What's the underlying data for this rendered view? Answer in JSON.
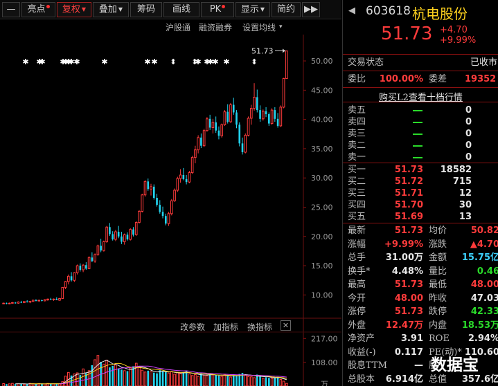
{
  "toolbar": {
    "buttons": [
      {
        "label": "—",
        "active": false,
        "dot": false,
        "caret": false
      },
      {
        "label": "亮点",
        "active": false,
        "dot": true,
        "caret": false
      },
      {
        "label": "复权",
        "active": true,
        "dot": false,
        "caret": true
      },
      {
        "label": "叠加",
        "active": false,
        "dot": false,
        "caret": true
      },
      {
        "label": "筹码",
        "active": false,
        "dot": false,
        "caret": false
      },
      {
        "label": "画线",
        "active": false,
        "dot": false,
        "caret": false
      },
      {
        "label": "PK",
        "active": false,
        "dot": true,
        "caret": false
      },
      {
        "label": "显示",
        "active": false,
        "dot": false,
        "caret": true
      },
      {
        "label": "简约",
        "active": false,
        "dot": false,
        "caret": false
      },
      {
        "label": "▶▶",
        "active": false,
        "dot": false,
        "caret": false
      }
    ]
  },
  "chart_toolbar": {
    "hgt": "沪股通",
    "margin": "融资融券",
    "ma_setting": "设置均线",
    "caret": "▾"
  },
  "chart_data": {
    "type": "candlestick",
    "price_axis": {
      "ticks": [
        "50.00",
        "45.00",
        "40.00",
        "35.00",
        "30.00",
        "25.00",
        "20.00",
        "15.00",
        "10.00"
      ],
      "ylim": [
        6.5,
        54.5
      ]
    },
    "last_price_marker": "51.73",
    "volume_axis": {
      "ticks": [
        "217.00",
        "108.00",
        "万"
      ],
      "ylim": [
        0,
        240
      ]
    },
    "candles": [
      [
        8.6,
        8.7,
        8.5,
        8.6
      ],
      [
        8.6,
        8.7,
        8.4,
        8.5
      ],
      [
        8.5,
        8.7,
        8.4,
        8.6
      ],
      [
        8.6,
        8.8,
        8.5,
        8.7
      ],
      [
        8.7,
        8.8,
        8.5,
        8.6
      ],
      [
        8.6,
        8.9,
        8.5,
        8.8
      ],
      [
        8.8,
        9.0,
        8.6,
        8.7
      ],
      [
        8.7,
        8.9,
        8.6,
        8.9
      ],
      [
        8.9,
        9.1,
        8.7,
        8.8
      ],
      [
        8.8,
        9.0,
        8.6,
        8.9
      ],
      [
        8.9,
        9.2,
        8.8,
        9.1
      ],
      [
        9.1,
        9.3,
        8.9,
        9.0
      ],
      [
        9.0,
        9.2,
        8.8,
        9.1
      ],
      [
        9.1,
        9.2,
        8.9,
        9.0
      ],
      [
        9.0,
        9.3,
        8.9,
        9.2
      ],
      [
        9.2,
        9.4,
        9.0,
        9.3
      ],
      [
        9.3,
        9.5,
        9.1,
        9.2
      ],
      [
        9.2,
        9.4,
        9.0,
        9.3
      ],
      [
        9.3,
        9.6,
        9.1,
        9.1
      ],
      [
        9.1,
        9.5,
        9.0,
        9.4
      ],
      [
        9.4,
        11.3,
        9.4,
        11.3
      ],
      [
        11.3,
        12.4,
        11.0,
        12.3
      ],
      [
        12.3,
        13.5,
        11.8,
        13.2
      ],
      [
        13.2,
        13.9,
        12.3,
        12.5
      ],
      [
        12.5,
        13.9,
        12.2,
        13.8
      ],
      [
        13.8,
        15.2,
        13.5,
        15.0
      ],
      [
        15.0,
        15.4,
        14.0,
        14.3
      ],
      [
        14.3,
        15.3,
        13.9,
        15.1
      ],
      [
        15.1,
        15.6,
        14.3,
        14.5
      ],
      [
        14.5,
        16.6,
        14.4,
        16.4
      ],
      [
        16.4,
        17.3,
        15.6,
        15.8
      ],
      [
        15.8,
        17.1,
        15.5,
        16.9
      ],
      [
        16.9,
        18.6,
        16.7,
        18.4
      ],
      [
        18.4,
        19.6,
        17.3,
        17.6
      ],
      [
        17.6,
        19.3,
        17.4,
        19.1
      ],
      [
        19.1,
        21.8,
        18.9,
        21.6
      ],
      [
        21.6,
        22.3,
        20.1,
        20.4
      ],
      [
        20.4,
        20.9,
        19.3,
        19.5
      ],
      [
        19.5,
        21.1,
        19.2,
        20.8
      ],
      [
        20.8,
        21.8,
        19.7,
        20.0
      ],
      [
        20.0,
        20.8,
        18.7,
        19.1
      ],
      [
        19.1,
        20.5,
        18.6,
        20.3
      ],
      [
        20.3,
        20.7,
        19.3,
        19.5
      ],
      [
        19.5,
        21.4,
        19.3,
        21.2
      ],
      [
        21.2,
        21.6,
        20.0,
        20.3
      ],
      [
        20.3,
        22.6,
        20.1,
        22.4
      ],
      [
        22.4,
        24.5,
        22.2,
        24.3
      ],
      [
        24.3,
        27.3,
        24.1,
        27.1
      ],
      [
        27.1,
        29.6,
        26.8,
        29.4
      ],
      [
        29.4,
        29.9,
        27.8,
        28.1
      ],
      [
        28.1,
        29.0,
        27.0,
        28.5
      ],
      [
        28.5,
        28.9,
        26.3,
        26.6
      ],
      [
        26.6,
        27.3,
        25.1,
        25.4
      ],
      [
        25.4,
        26.2,
        23.9,
        24.2
      ],
      [
        24.2,
        25.1,
        23.1,
        23.5
      ],
      [
        23.5,
        23.9,
        21.9,
        22.2
      ],
      [
        22.2,
        24.2,
        21.8,
        23.9
      ],
      [
        23.9,
        26.4,
        23.6,
        26.1
      ],
      [
        26.1,
        28.2,
        25.9,
        27.9
      ],
      [
        27.9,
        30.2,
        27.6,
        29.9
      ],
      [
        29.9,
        31.5,
        29.2,
        30.5
      ],
      [
        30.5,
        31.7,
        29.6,
        29.8
      ],
      [
        29.8,
        30.5,
        28.9,
        29.3
      ],
      [
        29.3,
        31.2,
        29.1,
        30.9
      ],
      [
        30.9,
        33.8,
        30.7,
        33.5
      ],
      [
        33.5,
        35.5,
        32.5,
        34.8
      ],
      [
        34.8,
        37.3,
        34.2,
        36.9
      ],
      [
        36.9,
        37.6,
        35.1,
        35.5
      ],
      [
        35.5,
        38.4,
        35.3,
        38.1
      ],
      [
        38.1,
        40.4,
        37.9,
        40.1
      ],
      [
        40.1,
        40.8,
        38.2,
        38.6
      ],
      [
        38.6,
        40.1,
        37.6,
        39.5
      ],
      [
        39.5,
        40.5,
        37.7,
        38.1
      ],
      [
        38.1,
        38.8,
        36.6,
        37.2
      ],
      [
        37.2,
        39.3,
        36.9,
        39.1
      ],
      [
        39.1,
        41.6,
        38.9,
        41.3
      ],
      [
        41.3,
        42.6,
        39.3,
        39.6
      ],
      [
        39.6,
        42.8,
        39.4,
        42.5
      ],
      [
        42.5,
        43.7,
        40.8,
        41.2
      ],
      [
        41.2,
        41.6,
        38.5,
        39.1
      ],
      [
        39.1,
        39.5,
        35.4,
        35.9
      ],
      [
        35.9,
        36.9,
        34.0,
        34.4
      ],
      [
        34.4,
        37.6,
        34.2,
        37.3
      ],
      [
        37.3,
        40.5,
        37.1,
        40.2
      ],
      [
        40.2,
        42.5,
        39.1,
        41.9
      ],
      [
        41.9,
        46.2,
        41.5,
        43.8
      ],
      [
        43.8,
        45.1,
        41.2,
        41.6
      ],
      [
        41.6,
        42.4,
        39.6,
        40.1
      ],
      [
        40.1,
        41.7,
        39.8,
        41.4
      ],
      [
        41.4,
        42.1,
        40.4,
        40.9
      ],
      [
        40.9,
        41.2,
        38.9,
        39.3
      ],
      [
        39.3,
        41.9,
        39.1,
        41.6
      ],
      [
        41.6,
        42.1,
        39.6,
        40.1
      ],
      [
        40.1,
        41.1,
        38.6,
        38.9
      ],
      [
        38.9,
        42.4,
        38.7,
        42.1
      ],
      [
        42.1,
        47.1,
        41.9,
        47.0
      ],
      [
        47.0,
        51.7,
        47.0,
        51.7
      ]
    ],
    "volumes": [
      11,
      9,
      10,
      12,
      9,
      10,
      11,
      8,
      9,
      12,
      10,
      9,
      11,
      10,
      9,
      12,
      10,
      9,
      11,
      10,
      20,
      45,
      62,
      48,
      55,
      60,
      50,
      78,
      58,
      70,
      95,
      120,
      140,
      110,
      100,
      118,
      85,
      92,
      96,
      80,
      75,
      70,
      68,
      82,
      90,
      104,
      88,
      72,
      64,
      70,
      66,
      61,
      58,
      72,
      69,
      63,
      59,
      66,
      54,
      61,
      57,
      62,
      69,
      55,
      48,
      52,
      44,
      58,
      50,
      47,
      55,
      51,
      49,
      48,
      44,
      52,
      46,
      41,
      50,
      47,
      55,
      60,
      49,
      43,
      42,
      38,
      52,
      47,
      35,
      40,
      37,
      34,
      39,
      41,
      30,
      22,
      12
    ]
  },
  "volume_toolbar": {
    "modify": "改参数",
    "add": "加指标",
    "swap": "换指标",
    "close": "✕"
  },
  "quote": {
    "nav_left": "◀",
    "nav_right": "▶",
    "code": "603618",
    "name": "杭电股份",
    "price": "51.73",
    "change": "+4.70",
    "change_pct": "+9.99%",
    "status_label": "交易状态",
    "status_value": "已收市",
    "weibi_label": "委比",
    "weibi_value": "100.00%",
    "weicha_label": "委差",
    "weicha_value": "19352",
    "l2_link": "购买L2查看十档行情"
  },
  "orderbook": {
    "asks": [
      {
        "label": "卖五",
        "vol": "0"
      },
      {
        "label": "卖四",
        "vol": "0"
      },
      {
        "label": "卖三",
        "vol": "0"
      },
      {
        "label": "卖二",
        "vol": "0"
      },
      {
        "label": "卖一",
        "vol": "0"
      }
    ],
    "bids": [
      {
        "label": "买一",
        "price": "51.73",
        "vol": "18582"
      },
      {
        "label": "买二",
        "price": "51.72",
        "vol": "715"
      },
      {
        "label": "买三",
        "price": "51.71",
        "vol": "12"
      },
      {
        "label": "买四",
        "price": "51.70",
        "vol": "30"
      },
      {
        "label": "买五",
        "price": "51.69",
        "vol": "13"
      }
    ]
  },
  "stats": [
    {
      "l1": "最新",
      "v1": "51.73",
      "c1": "red",
      "l2": "均价",
      "v2": "50.82",
      "c2": "red"
    },
    {
      "l1": "涨幅",
      "v1": "+9.99%",
      "c1": "red",
      "l2": "涨跌",
      "v2": "▲4.70",
      "c2": "red"
    },
    {
      "l1": "总手",
      "v1": "31.00万",
      "c1": "white",
      "l2": "金额",
      "v2": "15.75亿",
      "c2": "cyan"
    },
    {
      "l1": "换手*",
      "v1": "4.48%",
      "c1": "white",
      "l2": "量比",
      "v2": "0.46",
      "c2": "green"
    },
    {
      "l1": "最高",
      "v1": "51.73",
      "c1": "red",
      "l2": "最低",
      "v2": "48.00",
      "c2": "red"
    },
    {
      "l1": "今开",
      "v1": "48.00",
      "c1": "red",
      "l2": "昨收",
      "v2": "47.03",
      "c2": "white"
    },
    {
      "l1": "涨停",
      "v1": "51.73",
      "c1": "red",
      "l2": "跌停",
      "v2": "42.33",
      "c2": "green"
    },
    {
      "l1": "外盘",
      "v1": "12.47万",
      "c1": "red",
      "l2": "内盘",
      "v2": "18.53万",
      "c2": "green"
    },
    {
      "l1": "净资产",
      "v1": "3.91",
      "c1": "white",
      "l2": "ROE",
      "v2": "2.94%",
      "c2": "white"
    },
    {
      "l1": "收益(-)",
      "v1": "0.117",
      "c1": "white",
      "l2": "PE(动)*",
      "v2": "110.60",
      "c2": "white"
    },
    {
      "l1": "股息TTM",
      "v1": "—",
      "c1": "white",
      "l2": "股",
      "v2": "",
      "c2": "white"
    },
    {
      "l1": "总股本",
      "v1": "6.914亿",
      "c1": "white",
      "l2": "总值",
      "v2": "357.6亿",
      "c2": "white"
    }
  ],
  "watermark": "数据宝"
}
